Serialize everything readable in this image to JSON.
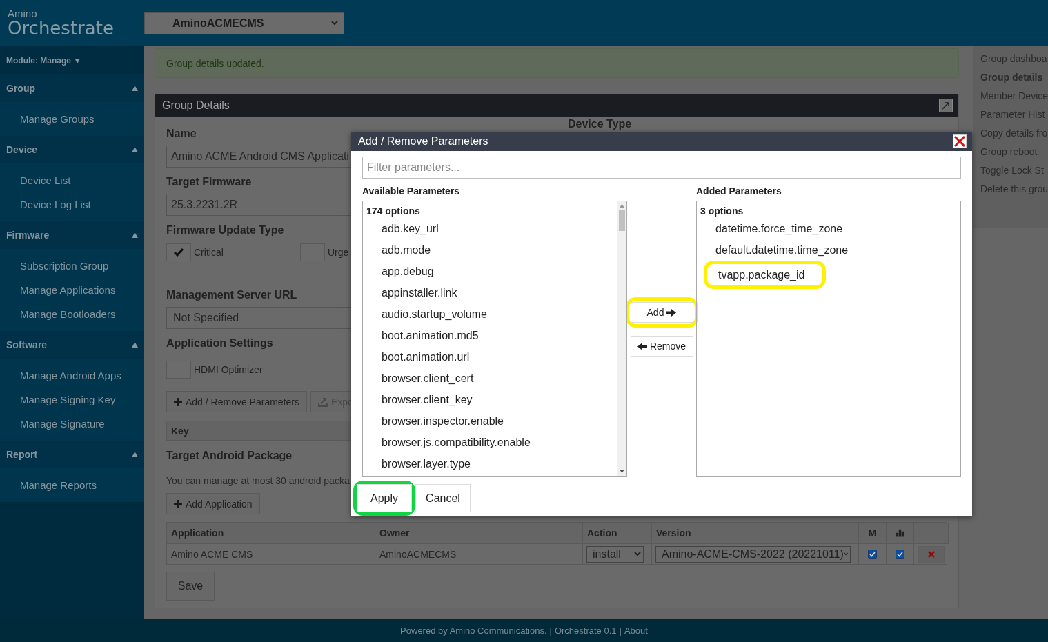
{
  "header": {
    "logo_top": "Amino",
    "logo_main": "Orchestrate",
    "account_select": "AminoACMECMS"
  },
  "sidebar": {
    "module": "Module: Manage ▼",
    "sections": [
      {
        "title": "Group",
        "expanded": true,
        "items": [
          "Manage Groups"
        ]
      },
      {
        "title": "Device",
        "expanded": true,
        "items": [
          "Device List",
          "Device Log List"
        ]
      },
      {
        "title": "Firmware",
        "expanded": true,
        "items": [
          "Subscription Group",
          "Manage Applications",
          "Manage Bootloaders"
        ]
      },
      {
        "title": "Software",
        "expanded": true,
        "items": [
          "Manage Android Apps",
          "Manage Signing Key",
          "Manage Signature"
        ]
      },
      {
        "title": "Report",
        "expanded": true,
        "items": [
          "Manage Reports"
        ]
      }
    ]
  },
  "alert": "Group details updated.",
  "panel": {
    "title": "Group Details",
    "name": {
      "label": "Name",
      "value": "Amino ACME Android CMS Applicati"
    },
    "device_type": {
      "label": "Device Type"
    },
    "target_firmware": {
      "label": "Target Firmware",
      "value": "25.3.2231.2R"
    },
    "update_type": {
      "label": "Firmware Update Type",
      "options": [
        {
          "label": "Critical",
          "checked": true
        },
        {
          "label": "Urge",
          "checked": false
        }
      ]
    },
    "server_url": {
      "label": "Management Server URL",
      "value": "Not Specified"
    },
    "app_settings": {
      "label": "Application Settings",
      "options": [
        {
          "label": "HDMI Optimizer",
          "checked": false
        }
      ]
    },
    "param_buttons": [
      {
        "label": "Add / Remove Parameters",
        "kind": "add",
        "disabled": false
      },
      {
        "label": "Expo",
        "kind": "export",
        "disabled": true
      }
    ],
    "key_column": "Key",
    "package": {
      "title": "Target Android Package",
      "note": "You can manage at most 30 android packa",
      "add_button": "Add Application"
    },
    "apps_table": {
      "columns": [
        "Application",
        "Owner",
        "Action",
        "Version",
        "M"
      ],
      "rows": [
        {
          "application": "Amino ACME CMS",
          "owner": "AminoACMECMS",
          "action": "install",
          "version": "Amino-ACME-CMS-2022 (20221011)",
          "m": true,
          "stats": true
        }
      ]
    },
    "save": "Save"
  },
  "right_nav": [
    {
      "label": "Group dashboa",
      "selected": false
    },
    {
      "label": "Group details",
      "selected": true
    },
    {
      "label": "Member Device",
      "selected": false
    },
    {
      "label": "Parameter Hist",
      "selected": false
    },
    {
      "label": "Copy details fro",
      "selected": false
    },
    {
      "label": "Group reboot",
      "selected": false
    },
    {
      "label": "Toggle Lock St",
      "selected": false
    },
    {
      "label": "Delete this grou",
      "selected": false
    }
  ],
  "modal": {
    "title": "Add / Remove Parameters",
    "filter_placeholder": "Filter parameters...",
    "available": {
      "label": "Available Parameters",
      "count": "174 options",
      "items": [
        {
          "label": "adb.key_url"
        },
        {
          "label": "adb.mode"
        },
        {
          "label": "app.debug"
        },
        {
          "label": "appinstaller.link"
        },
        {
          "label": "audio.startup_volume"
        },
        {
          "label": "boot.animation.md5"
        },
        {
          "label": "boot.animation.url"
        },
        {
          "label": "browser.client_cert"
        },
        {
          "label": "browser.client_key"
        },
        {
          "label": "browser.inspector.enable"
        },
        {
          "label": "browser.js.compatibility.enable"
        },
        {
          "label": "browser.layer.type"
        }
      ]
    },
    "added": {
      "label": "Added Parameters",
      "count": "3 options",
      "items": [
        {
          "label": "datetime.force_time_zone"
        },
        {
          "label": "default.datetime.time_zone"
        },
        {
          "label": "tvapp.package_id",
          "highlighted": true
        }
      ]
    },
    "add_button": {
      "label": "Add",
      "highlighted": true
    },
    "remove_button": {
      "label": "Remove",
      "highlighted": false
    },
    "apply_button": {
      "label": "Apply",
      "highlighted": true
    },
    "cancel_button": {
      "label": "Cancel"
    }
  },
  "footer": {
    "separator": "|",
    "links": [
      "Powered by Amino Communications.",
      "Orchestrate 0.1",
      "About"
    ]
  }
}
